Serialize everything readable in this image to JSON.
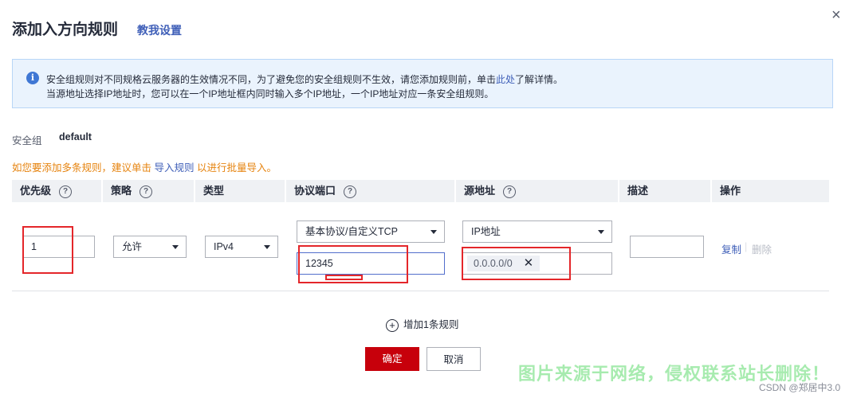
{
  "header": {
    "title": "添加入方向规则",
    "help_link": "教我设置",
    "close_glyph": "×"
  },
  "notice": {
    "line1_prefix": "安全组规则对不同规格云服务器的生效情况不同，为了避免您的安全组规则不生效，请您添加规则前，单击",
    "line1_link": "此处",
    "line1_suffix": "了解详情。",
    "line2": "当源地址选择IP地址时，您可以在一个IP地址框内同时输入多个IP地址，一个IP地址对应一条安全组规则。"
  },
  "security_group": {
    "label": "安全组",
    "value": "default"
  },
  "hint": {
    "prefix": "如您要添加多条规则，建议单击 ",
    "link": "导入规则",
    "suffix": " 以进行批量导入。"
  },
  "table": {
    "headers": {
      "priority": "优先级",
      "policy": "策略",
      "type": "类型",
      "protocol_port": "协议端口",
      "source": "源地址",
      "description": "描述",
      "operation": "操作"
    },
    "help_glyph": "?",
    "row": {
      "priority": "1",
      "policy": "允许",
      "type": "IPv4",
      "protocol": "基本协议/自定义TCP",
      "port": "12345",
      "source_type": "IP地址",
      "source_tag": "0.0.0.0/0",
      "tag_remove_glyph": "✕",
      "description": "",
      "copy": "复制",
      "delete": "删除",
      "op_separator": "|"
    }
  },
  "add_rule": {
    "glyph": "+",
    "label": "增加1条规则"
  },
  "buttons": {
    "confirm": "确定",
    "cancel": "取消"
  },
  "watermark": "图片来源于网络，侵权联系站长删除！",
  "credit": "CSDN @郑居中3.0",
  "colors": {
    "primary": "#c7000b",
    "link": "#3f5fb8",
    "annotation": "#e4262a",
    "hint": "#e6830e"
  }
}
